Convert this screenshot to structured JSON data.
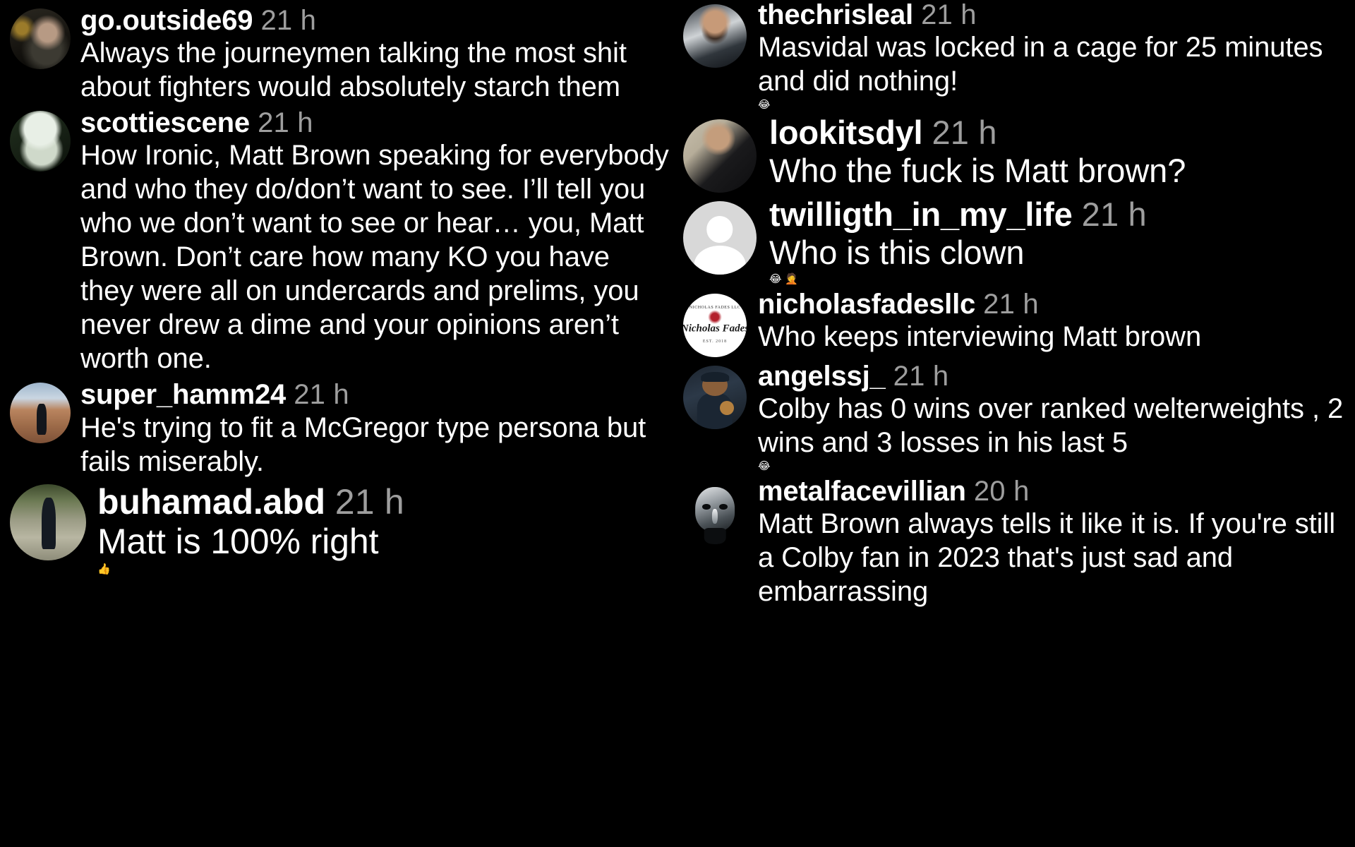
{
  "app": {
    "background_color": "#000000",
    "text_color": "#ffffff",
    "timestamp_color": "#9e9e9e"
  },
  "left_column": {
    "comments": [
      {
        "username": "go.outside69",
        "timestamp": "21 h",
        "avatar": "bearded-man-photo",
        "text": "Always the journeymen talking the most shit about fighters would absolutely starch them"
      },
      {
        "username": "scottiescene",
        "timestamp": "21 h",
        "avatar": "cartoon-green-cap-photo",
        "text": "How Ironic, Matt Brown speaking for everybody and who they do/don’t want to see. I’ll tell you who we don’t want to see or hear… you, Matt Brown. Don’t care how many KO you have they were all on undercards and prelims, you never drew a dime and your opinions aren’t worth one."
      },
      {
        "username": "super_hamm24",
        "timestamp": "21 h",
        "avatar": "canyon-hiker-photo",
        "text": "He's trying to fit a McGregor type persona but fails miserably."
      },
      {
        "username": "buhamad.abd",
        "timestamp": "21 h",
        "avatar": "street-walker-photo",
        "text": "Matt is 100% right ",
        "emoji": "👍"
      }
    ]
  },
  "right_column": {
    "comments": [
      {
        "username": "thechrisleal",
        "timestamp": "21 h",
        "avatar": "man-in-car-photo",
        "text": "Masvidal was locked in a cage for 25 minutes and did nothing! ",
        "emoji": "😂"
      },
      {
        "username": "lookitsdyl",
        "timestamp": "21 h",
        "avatar": "mirror-selfie-photo",
        "text": "Who the fuck is Matt brown?"
      },
      {
        "username": "twilligth_in_my_life",
        "timestamp": "21 h",
        "avatar": "default-profile-icon",
        "text": "Who is this clown ",
        "emoji": "😂 🤦"
      },
      {
        "username": "nicholasfadesllc",
        "timestamp": "21 h",
        "avatar": "nicholas-fades-logo",
        "text": "Who keeps interviewing Matt brown"
      },
      {
        "username": "angelssj_",
        "timestamp": "21 h",
        "avatar": "teddy-bear-photo",
        "text": "Colby has 0 wins over ranked welterweights , 2 wins and 3 losses in his last 5 ",
        "emoji": "😂"
      },
      {
        "username": "metalfacevillian",
        "timestamp": "20 h",
        "avatar": "metal-mask-photo",
        "text": "Matt Brown always tells it like it is. If you're still a Colby fan in 2023 that's just sad and embarrassing"
      }
    ]
  },
  "avatar_logo": {
    "arc_text": "NICHOLAS FADES LLC",
    "script_text": "Nicholas Fades",
    "sub_text": "EST. 2018"
  }
}
